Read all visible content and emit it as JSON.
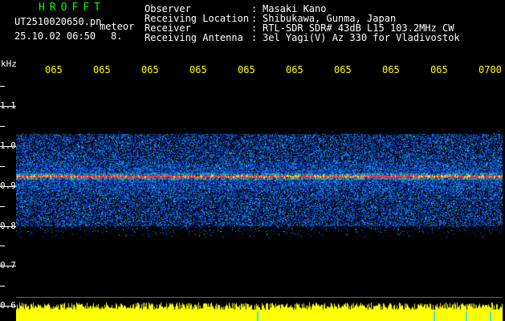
{
  "header": {
    "brand": "HROFFT",
    "filename": "UT2510020650.pn",
    "meteor_label": "meteor",
    "datetime": "25.10.02 06:50",
    "count": "8.",
    "fields": [
      {
        "key": "Observer",
        "value": "Masaki Kano"
      },
      {
        "key": "Receiving Location",
        "value": "Shibukawa, Gunma, Japan"
      },
      {
        "key": "Receiver",
        "value": "RTL-SDR SDR# 43dB L15 103.2MHz CW"
      },
      {
        "key": "Receiving Antenna",
        "value": "3el Yagi(V) Az 330 for Vladivostok"
      }
    ]
  },
  "axis": {
    "unit": "kHz",
    "y_labels": [
      "1.1",
      "1.0",
      "0.9",
      "0.8",
      "0.7",
      "0.6"
    ],
    "time_labels": [
      "065",
      "065",
      "065",
      "065",
      "065",
      "065",
      "065",
      "065",
      "065",
      "0700"
    ]
  },
  "colors": {
    "background": "#000000",
    "header_green": "#00ff00",
    "header_text": "#ffffff",
    "axis_yellow": "#ffff00",
    "noise_blue": "#1a2aa8",
    "signal_red": "#ff3050",
    "level_yellow": "#ffff00"
  },
  "signal": {
    "center_khz": 0.925,
    "band_low_khz": 0.8,
    "band_high_khz": 1.03
  }
}
